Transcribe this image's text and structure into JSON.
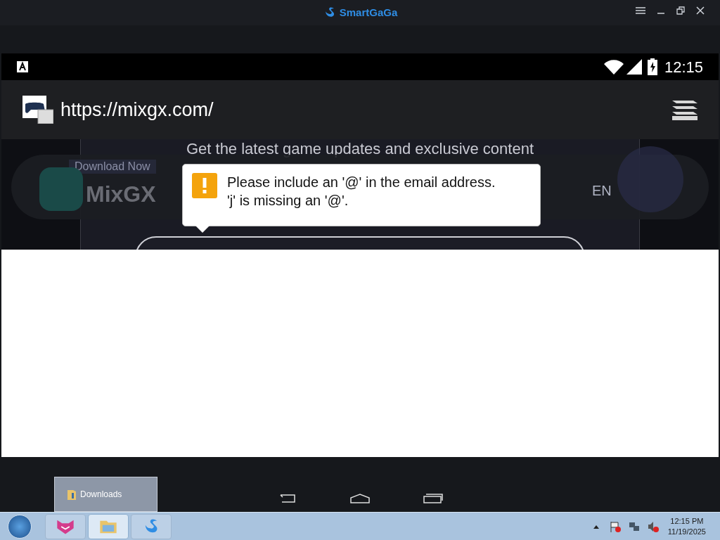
{
  "window": {
    "title": "SmartGaGa"
  },
  "status_bar": {
    "time": "12:15"
  },
  "browser": {
    "url": "https://mixgx.com/"
  },
  "page": {
    "tagline": "Get the latest game updates and exclusive content",
    "download_button": "Download Now",
    "brand": "MixGX",
    "language": "EN"
  },
  "validation_tooltip": {
    "lines": [
      "Please include an '@' in the email address.",
      "'j' is missing an '@'."
    ]
  },
  "taskbar": {
    "preview": "Downloads",
    "apps": [
      {
        "kind": "cat",
        "selected": false
      },
      {
        "kind": "folder",
        "selected": true
      },
      {
        "kind": "swan",
        "selected": false
      }
    ],
    "clock_time": "12:15 PM",
    "clock_date": "11/19/2025"
  }
}
